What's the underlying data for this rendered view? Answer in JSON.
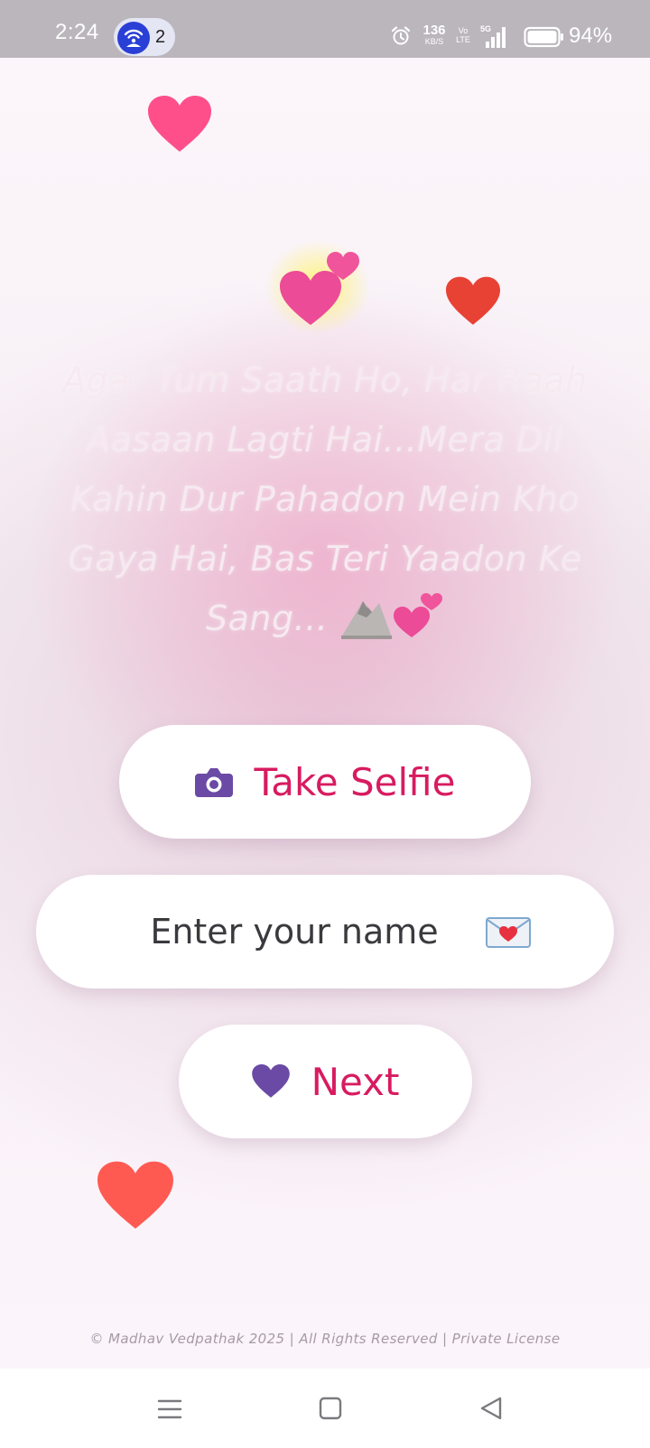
{
  "status_bar": {
    "time": "2:24",
    "hotspot_count": "2",
    "speed_value": "136",
    "speed_unit": "KB/S",
    "volte_line1": "Vo",
    "volte_line2": "LTE",
    "network": "5G",
    "battery": "94%",
    "bg_color": "#bab6bc"
  },
  "quote": {
    "text": "Agar Tum Saath Ho, Har Raah Aasaan Lagti Hai...Mera Dil Kahin Dur Pahadon Mein Kho Gaya Hai, Bas Teri Yaadon Ke Sang...",
    "trailing_icons": [
      "mountain-icon",
      "two-hearts-icon"
    ]
  },
  "selfie_button": {
    "label": "Take Selfie",
    "icon": "camera-icon"
  },
  "name_field": {
    "placeholder": "Enter your name",
    "icon": "love-letter-icon"
  },
  "next_button": {
    "label": "Next",
    "icon": "purple-heart-icon"
  },
  "footer": {
    "text": "© Madhav Vedpathak 2025 | All Rights Reserved | Private License"
  },
  "decorations": [
    "pink-heart-icon",
    "two-hearts-icon",
    "red-heart-icon",
    "red-heart-icon"
  ],
  "colors": {
    "accent": "#d81b60",
    "icon_purple": "#6a4aa5",
    "heart_pink": "#fe4f8a",
    "heart_red": "#e84234",
    "heart_coral": "#ff5a52"
  },
  "nav_bar": {
    "buttons": [
      "menu-icon",
      "home-icon",
      "back-icon"
    ]
  }
}
